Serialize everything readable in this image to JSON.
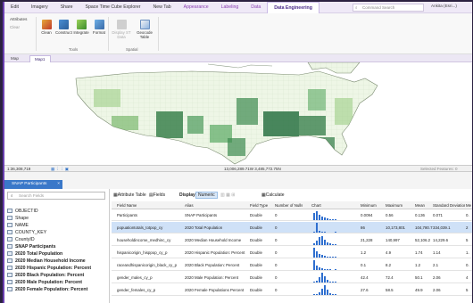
{
  "tabs": [
    "Edit",
    "Imagery",
    "Share",
    "Space Time Cube Explorer",
    "New Tab",
    "Appearance",
    "Labeling",
    "Data",
    "Data Engineering"
  ],
  "active_tab_index": 8,
  "command_search": {
    "placeholder": "Command Search"
  },
  "user": "Ankita (Esri...)",
  "ribbon": {
    "attributes_label": "Attributes",
    "clear_label": "Clear",
    "tools": [
      "Clean",
      "Construct",
      "Integrate",
      "Format"
    ],
    "tools_group": "Tools",
    "display_label": "Display ST Data",
    "geocode_label": "Geocode Table",
    "spatial_group": "Spatial"
  },
  "map_tabs": [
    "Map",
    "Map1"
  ],
  "map_status": {
    "scale": "1:36,308,719",
    "coordinates": "13,006,289.71W 3,485,772.75N",
    "selected": "Selected Features: 0"
  },
  "panel_tab": "SNAP Participants",
  "field_search": {
    "placeholder": "Search Fields"
  },
  "fields": [
    {
      "name": "OBJECTID",
      "bold": false
    },
    {
      "name": "Shape",
      "bold": false
    },
    {
      "name": "NAME",
      "bold": false
    },
    {
      "name": "COUNTY_KEY",
      "bold": false
    },
    {
      "name": "CountyID",
      "bold": false
    },
    {
      "name": "SNAP Participants",
      "bold": true
    },
    {
      "name": "2020 Total Population",
      "bold": true
    },
    {
      "name": "2020 Median Household Income",
      "bold": true
    },
    {
      "name": "2020 Hispanic Population: Percent",
      "bold": true
    },
    {
      "name": "2020 Black Population: Percent",
      "bold": true
    },
    {
      "name": "2020 Male Population: Percent",
      "bold": true
    },
    {
      "name": "2020 Female Population: Percent",
      "bold": true
    }
  ],
  "table_toolbar": {
    "attribute_table": "Attribute Table",
    "fields": "Fields",
    "display": "Display:",
    "numeric": "Numeric",
    "calculate": "Calculate"
  },
  "columns": [
    "Field Name",
    "Alias",
    "Field Type",
    "Number of Nulls",
    "Chart",
    "Minimum",
    "Maximum",
    "Mean",
    "Standard Deviation",
    "Me"
  ],
  "rows": [
    {
      "field": "Participants",
      "alias": "SNAP Participants",
      "type": "Double",
      "nulls": "0",
      "min": "0.0094",
      "max": "0.56",
      "mean": "0.136",
      "std": "0.071",
      "med": "0.",
      "sel": false
    },
    {
      "field": "popuationtotals_totpop_cy",
      "alias": "2020 Total Population",
      "type": "Double",
      "nulls": "0",
      "min": "86",
      "max": "10,173,801",
      "mean": "104,780.7",
      "std": "334,039.1",
      "med": "2",
      "sel": true
    },
    {
      "field": "householdincome_medhinc_cy",
      "alias": "2020 Median Household Income",
      "type": "Double",
      "nulls": "0",
      "min": "21,228",
      "max": "140,997",
      "mean": "52,106.2",
      "std": "14,229.6",
      "med": "5",
      "sel": false
    },
    {
      "field": "hispanicorigin_hisppop_cy_p",
      "alias": "2020 Hispanic Population: Percent",
      "type": "Double",
      "nulls": "0",
      "min": "1.2",
      "max": "4.9",
      "mean": "1.74",
      "std": "1.14",
      "med": "1.",
      "sel": false
    },
    {
      "field": "raceandhispanicorigin_black_cy_p",
      "alias": "2020 Black Population: Percent",
      "type": "Double",
      "nulls": "0",
      "min": "0.1",
      "max": "8.2",
      "mean": "1.2",
      "std": "2.1",
      "med": "0.",
      "sel": false
    },
    {
      "field": "gender_males_cy_p",
      "alias": "2020 Male Population: Percent",
      "type": "Double",
      "nulls": "0",
      "min": "42.4",
      "max": "72.4",
      "mean": "50.1",
      "std": "2.06",
      "med": "4",
      "sel": false
    },
    {
      "field": "gender_females_cy_p",
      "alias": "2020 Female Populations Percent",
      "type": "Double",
      "nulls": "0",
      "min": "27.6",
      "max": "58.5",
      "mean": "49.9",
      "std": "2.06",
      "med": "5",
      "sel": false
    }
  ],
  "colors": {
    "accent": "#6a3fb0",
    "selection": "#cfe1f7",
    "chart": "#2f6fcf",
    "map_dark": "#1e6a3a",
    "map_light": "#e9f3df"
  }
}
